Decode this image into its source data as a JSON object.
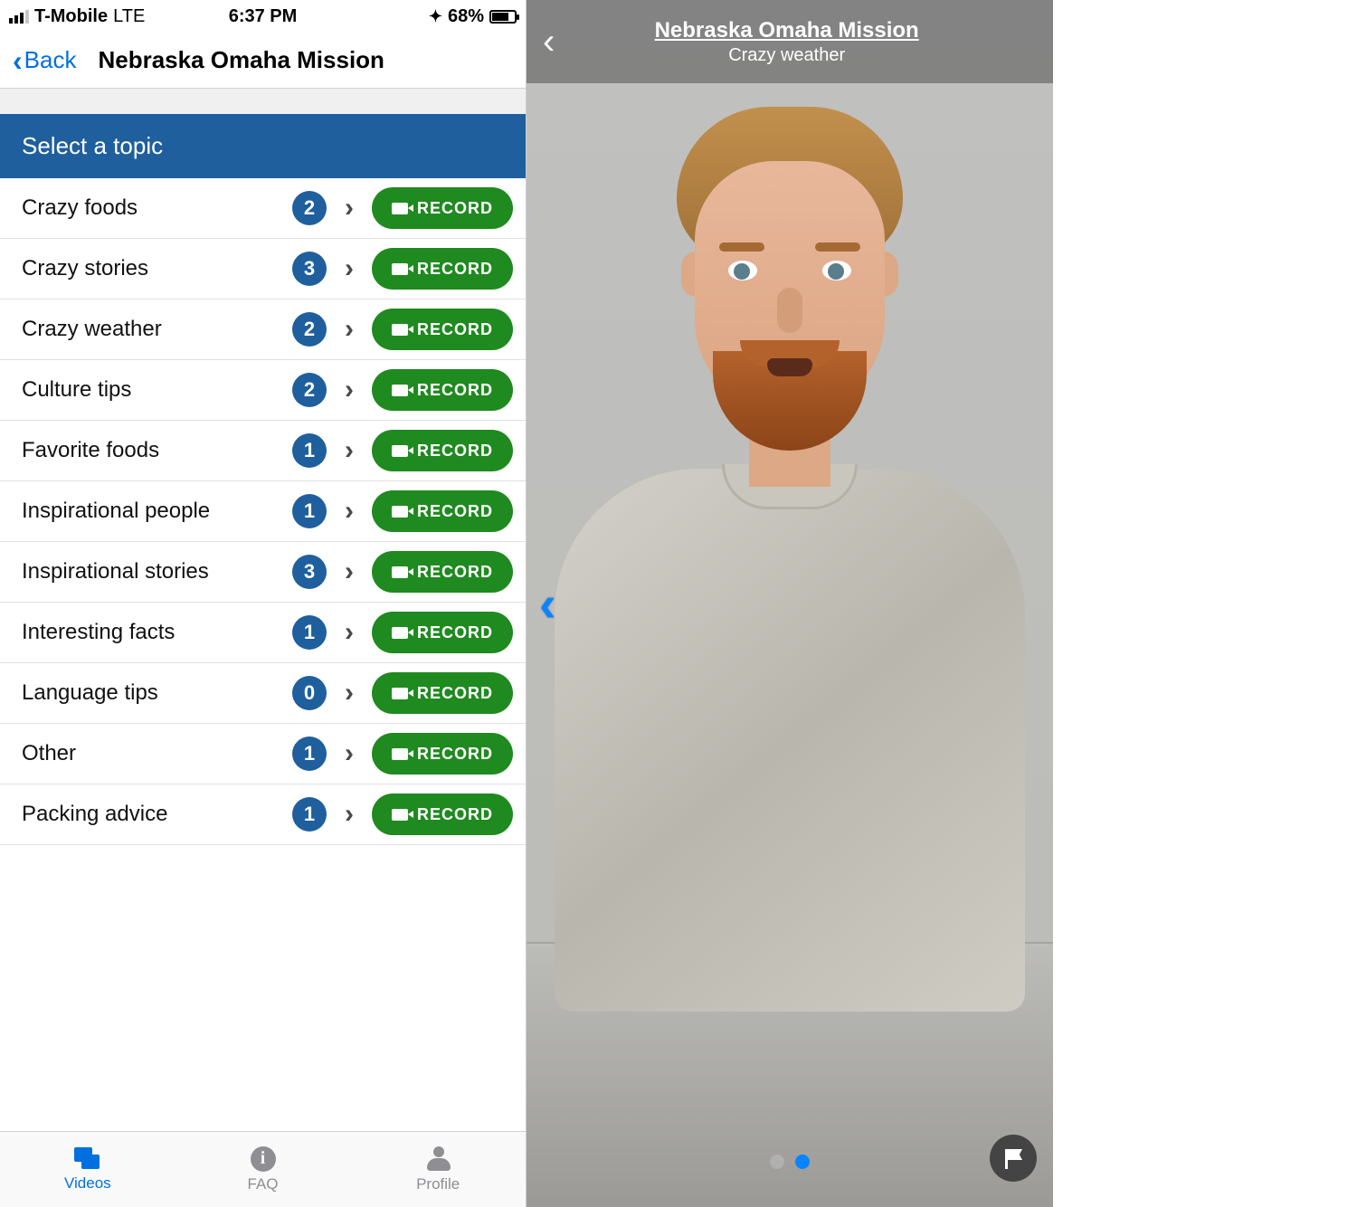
{
  "status_bar": {
    "carrier": "T-Mobile",
    "network": "LTE",
    "time": "6:37 PM",
    "battery_percent": "68%"
  },
  "nav": {
    "back_label": "Back",
    "title": "Nebraska Omaha Mission"
  },
  "section_header": "Select a topic",
  "record_label": "RECORD",
  "topics": [
    {
      "label": "Crazy foods",
      "count": "2"
    },
    {
      "label": "Crazy stories",
      "count": "3"
    },
    {
      "label": "Crazy weather",
      "count": "2"
    },
    {
      "label": "Culture tips",
      "count": "2"
    },
    {
      "label": "Favorite foods",
      "count": "1"
    },
    {
      "label": "Inspirational people",
      "count": "1"
    },
    {
      "label": "Inspirational stories",
      "count": "3"
    },
    {
      "label": "Interesting facts",
      "count": "1"
    },
    {
      "label": "Language tips",
      "count": "0"
    },
    {
      "label": "Other",
      "count": "1"
    },
    {
      "label": "Packing advice",
      "count": "1"
    }
  ],
  "tabs": {
    "videos": "Videos",
    "faq": "FAQ",
    "profile": "Profile"
  },
  "video_screen": {
    "title": "Nebraska Omaha Mission",
    "subtitle": "Crazy weather",
    "page_count": 2,
    "active_page_index": 1
  },
  "colors": {
    "ios_blue": "#0070e0",
    "header_blue": "#1f5f9d",
    "record_green": "#1f8a1f",
    "dot_active": "#0a84ff"
  }
}
